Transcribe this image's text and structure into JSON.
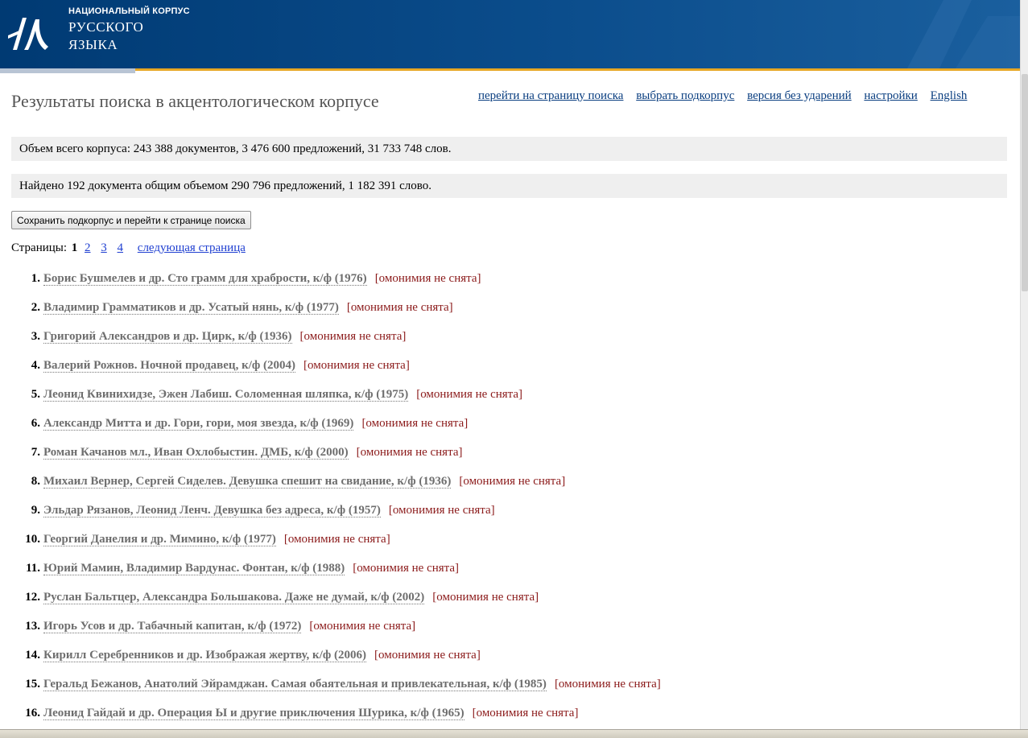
{
  "header": {
    "logo_line1": "НАЦИОНАЛЬНЫЙ КОРПУС",
    "logo_line2": "РУССКОГО",
    "logo_line3": "ЯЗЫКА",
    "colors": {
      "band": "#003a73",
      "accent": "#e7a724"
    }
  },
  "page_title": "Результаты поиска в акцентологическом корпусе",
  "nav": {
    "search_page": "перейти на страницу поиска",
    "subcorpus": "выбрать подкорпус",
    "no_stress": "версия без ударений",
    "settings": "настройки",
    "english": "English"
  },
  "corpus_info": "Объем всего корпуса: 243 388 документов, 3 476 600 предложений, 31 733 748 слов.",
  "found_info": "Найдено 192 документа общим объемом 290 796 предложений, 1 182 391 слово.",
  "save_button": "Сохранить подкорпус и перейти к странице поиска",
  "pager": {
    "label": "Страницы:",
    "current": "1",
    "pages": [
      "2",
      "3",
      "4"
    ],
    "next": "следующая страница"
  },
  "results": [
    {
      "num": "1.",
      "title": "Борис Бушмелев и др. Сто грамм для храбрости, к/ф (1976)",
      "tag": "[омонимия не снята]"
    },
    {
      "num": "2.",
      "title": "Владимир Грамматиков и др. Усатый нянь, к/ф (1977)",
      "tag": "[омонимия не снята]"
    },
    {
      "num": "3.",
      "title": "Григорий Александров и др. Цирк, к/ф (1936)",
      "tag": "[омонимия не снята]"
    },
    {
      "num": "4.",
      "title": "Валерий Рожнов. Ночной продавец, к/ф (2004)",
      "tag": "[омонимия не снята]"
    },
    {
      "num": "5.",
      "title": "Леонид Квинихидзе, Эжен Лабиш. Соломенная шляпка, к/ф (1975)",
      "tag": "[омонимия не снята]"
    },
    {
      "num": "6.",
      "title": "Александр Митта и др. Гори, гори, моя звезда, к/ф (1969)",
      "tag": "[омонимия не снята]"
    },
    {
      "num": "7.",
      "title": "Роман Качанов мл., Иван Охлобыстин. ДМБ, к/ф (2000)",
      "tag": "[омонимия не снята]"
    },
    {
      "num": "8.",
      "title": "Михаил Вернер, Сергей Сиделев. Девушка спешит на свидание, к/ф (1936)",
      "tag": "[омонимия не снята]"
    },
    {
      "num": "9.",
      "title": "Эльдар Рязанов, Леонид Ленч. Девушка без адреса, к/ф (1957)",
      "tag": "[омонимия не снята]"
    },
    {
      "num": "10.",
      "title": "Георгий Данелия и др. Мимино, к/ф (1977)",
      "tag": "[омонимия не снята]"
    },
    {
      "num": "11.",
      "title": "Юрий Мамин, Владимир Вардунас. Фонтан, к/ф (1988)",
      "tag": "[омонимия не снята]"
    },
    {
      "num": "12.",
      "title": "Руслан Бальтцер, Александра Большакова. Даже не думай, к/ф (2002)",
      "tag": "[омонимия не снята]"
    },
    {
      "num": "13.",
      "title": "Игорь Усов и др. Табачный капитан, к/ф (1972)",
      "tag": "[омонимия не снята]"
    },
    {
      "num": "14.",
      "title": "Кирилл Серебренников и др. Изображая жертву, к/ф (2006)",
      "tag": "[омонимия не снята]"
    },
    {
      "num": "15.",
      "title": "Геральд Бежанов, Анатолий Эйрамджан. Самая обаятельная и привлекательная, к/ф (1985)",
      "tag": "[омонимия не снята]"
    },
    {
      "num": "16.",
      "title": "Леонид Гайдай и др. Операция Ы и другие приключения Шурика, к/ф (1965)",
      "tag": "[омонимия не снята]"
    }
  ]
}
